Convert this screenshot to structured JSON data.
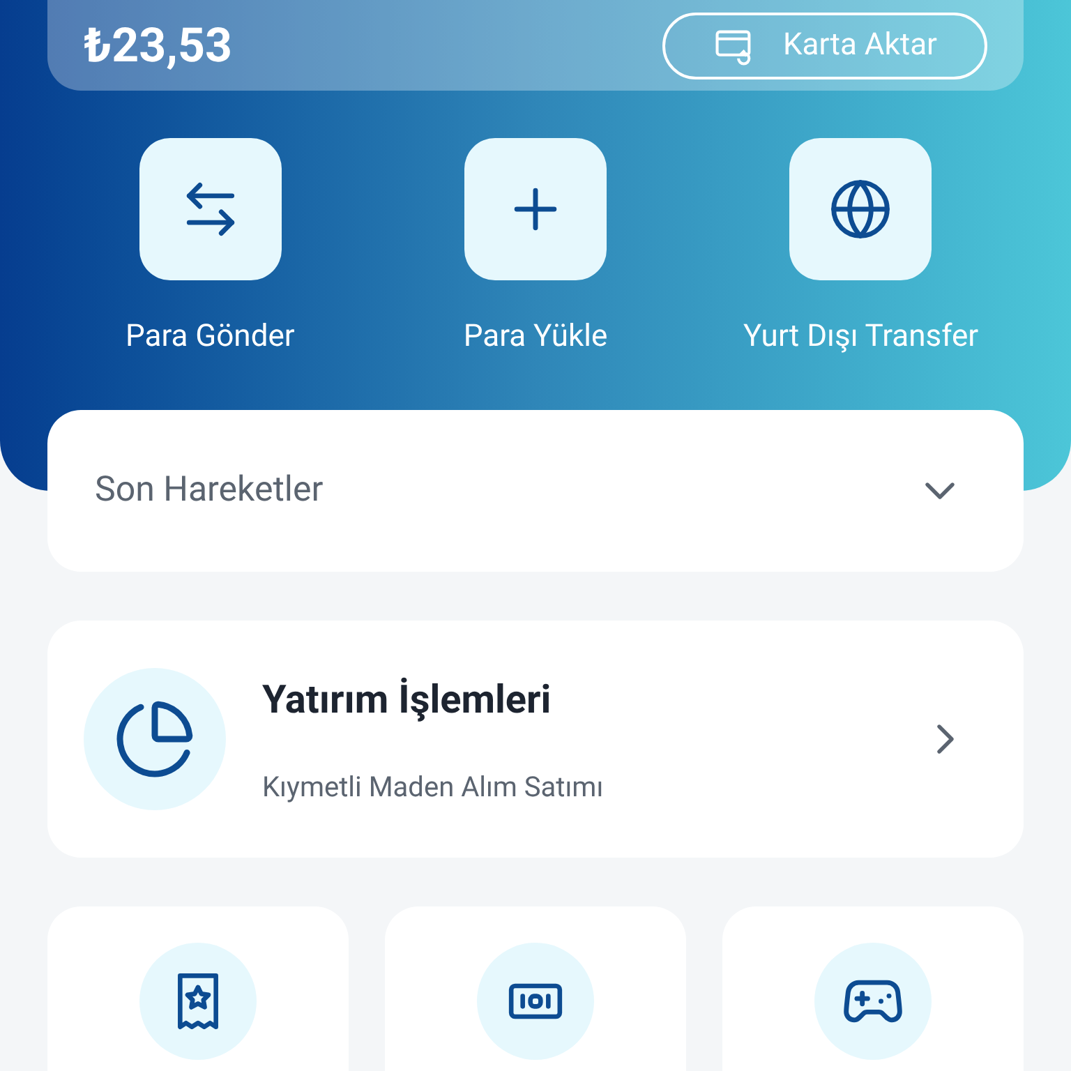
{
  "balance": {
    "amount": "₺23,53",
    "button": "Karta Aktar"
  },
  "actions": [
    {
      "label": "Para Gönder",
      "kind": "send"
    },
    {
      "label": "Para Yükle",
      "kind": "add"
    },
    {
      "label": "Yurt Dışı Transfer",
      "kind": "global"
    }
  ],
  "recent": {
    "title": "Son Hareketler",
    "expanded": false
  },
  "investment": {
    "title": "Yatırım İşlemleri",
    "subtitle": "Kıymetli Maden Alım Satımı"
  },
  "tiles": [
    {
      "kind": "receipt"
    },
    {
      "kind": "bill"
    },
    {
      "kind": "game"
    }
  ]
}
